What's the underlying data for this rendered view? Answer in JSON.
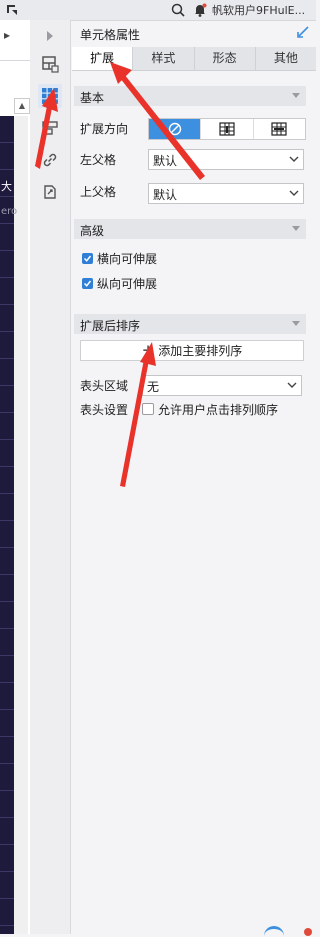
{
  "topbar": {
    "user_name": "帆软用户9FHulE...",
    "icons": [
      "corner-icon",
      "search-icon",
      "bell-icon"
    ]
  },
  "left_editor": {
    "collapse_mark": "▸",
    "cell_text_1": "大",
    "cell_text_2": "ero"
  },
  "toolbar": {
    "icons": [
      "cell-element-icon",
      "cell-attributes-icon",
      "condition-attributes-icon",
      "hyperlink-icon",
      "widget-icon"
    ],
    "active": "cell-attributes-icon"
  },
  "panel": {
    "title": "单元格属性",
    "tabs": [
      "扩展",
      "样式",
      "形态",
      "其他"
    ],
    "active_tab": "扩展",
    "basic": {
      "section_label": "基本",
      "direction_label": "扩展方向",
      "direction_options": [
        "no-expand-icon",
        "vertical-expand-icon",
        "horizontal-expand-icon"
      ],
      "direction_selected": "no-expand-icon",
      "left_parent_label": "左父格",
      "left_parent_value": "默认",
      "top_parent_label": "上父格",
      "top_parent_value": "默认"
    },
    "advanced": {
      "section_label": "高级",
      "horizontal_extend_label": "横向可伸展",
      "horizontal_extend_checked": true,
      "vertical_extend_label": "纵向可伸展",
      "vertical_extend_checked": true
    },
    "sort": {
      "section_label": "扩展后排序",
      "add_button_label": "添加主要排列序",
      "header_area_label": "表头区域",
      "header_area_value": "无",
      "header_setting_label": "表头设置",
      "allow_user_sort_label": "允许用户点击排列顺序",
      "allow_user_sort_checked": false
    }
  },
  "colors": {
    "accent": "#3d8fe0",
    "checkbox": "#2f7fd6",
    "annotation_arrow": "#e8322a",
    "sheet_dark": "#1e1a3c"
  }
}
